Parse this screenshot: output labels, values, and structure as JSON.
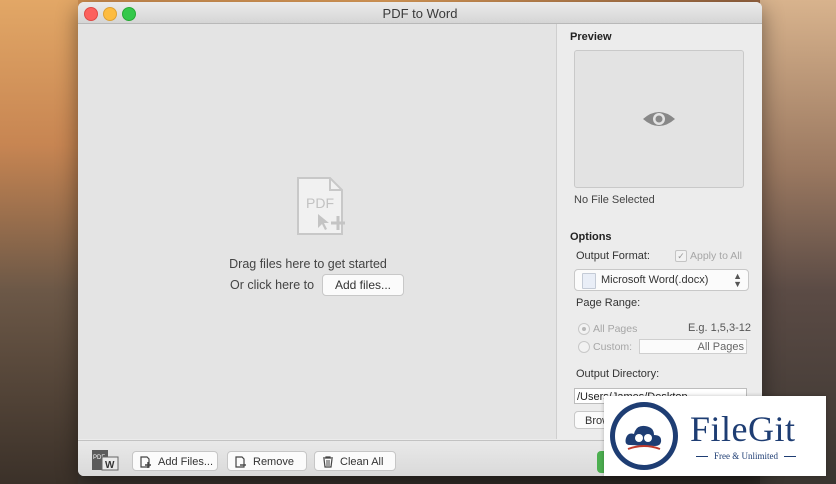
{
  "window": {
    "title": "PDF to Word"
  },
  "dropzone": {
    "drag_text": "Drag files here to get started",
    "click_text": "Or click here to",
    "add_files_label": "Add files..."
  },
  "preview": {
    "heading": "Preview",
    "status": "No File Selected"
  },
  "options": {
    "heading": "Options",
    "output_format_label": "Output Format:",
    "apply_to_all_label": "Apply to All",
    "apply_to_all_checked": true,
    "format_value": "Microsoft Word(.docx)",
    "page_range_label": "Page Range:",
    "all_pages_label": "All Pages",
    "all_pages_example": "E.g. 1,5,3-12",
    "custom_label": "Custom:",
    "custom_value": "All Pages",
    "output_directory_label": "Output Directory:",
    "output_directory_value": "/Users/James/Desktop",
    "browse_label": "Brow"
  },
  "toolbar": {
    "add_files_label": "Add Files...",
    "remove_label": "Remove",
    "clean_all_label": "Clean All"
  },
  "watermark": {
    "name": "FileGit",
    "tagline": "Free & Unlimited"
  },
  "colors": {
    "convert_accent": "#4caf50",
    "watermark_brand": "#1e3d73"
  }
}
